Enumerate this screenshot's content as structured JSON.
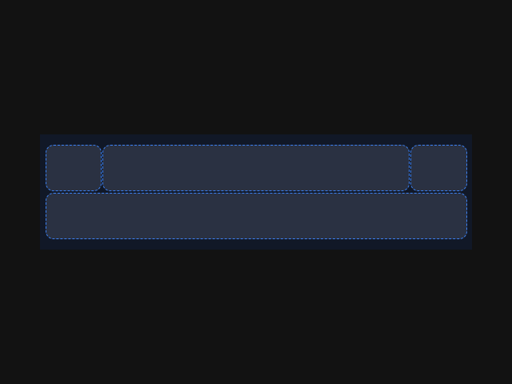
{
  "layout_grid": {
    "cells": [
      {
        "id": "a"
      },
      {
        "id": "b"
      },
      {
        "id": "c"
      },
      {
        "id": "d"
      }
    ]
  },
  "colors": {
    "page_background": "#121212",
    "container_background": "#111827",
    "cell_background": "#2a3142",
    "cell_border": "#3b82f6"
  }
}
